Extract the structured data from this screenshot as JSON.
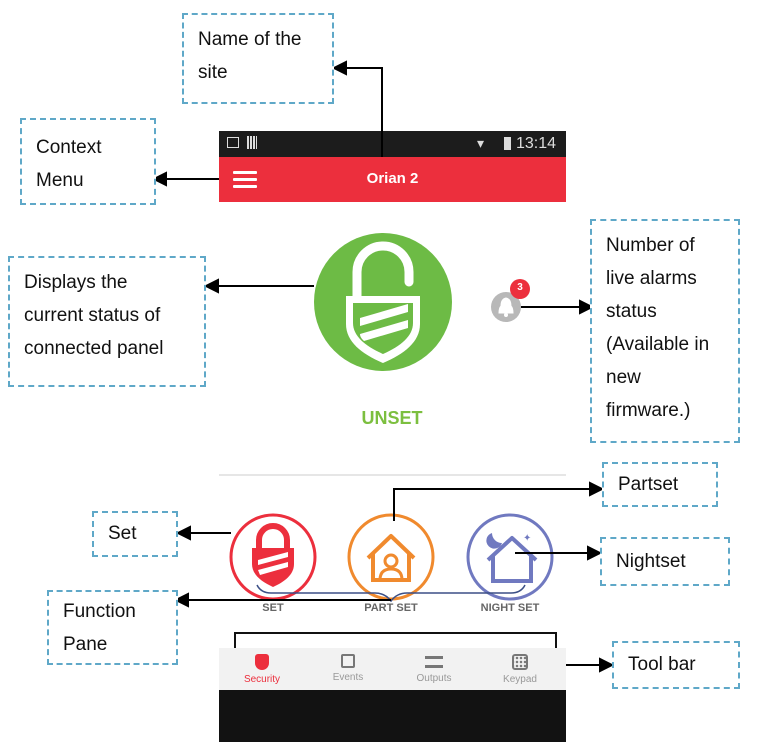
{
  "status_bar": {
    "time": "13:14"
  },
  "app_bar": {
    "title": "Orian 2"
  },
  "status": {
    "label": "UNSET",
    "alarm_count": "3"
  },
  "functions": [
    {
      "label": "SET"
    },
    {
      "label": "PART SET"
    },
    {
      "label": "NIGHT SET"
    }
  ],
  "toolbar": [
    {
      "label": "Security",
      "icon": "shield-icon",
      "active": true
    },
    {
      "label": "Events",
      "icon": "calendar-icon",
      "active": false
    },
    {
      "label": "Outputs",
      "icon": "toggles-icon",
      "active": false
    },
    {
      "label": "Keypad",
      "icon": "keypad-icon",
      "active": false
    }
  ],
  "callouts": {
    "site_name": "Name of the site",
    "context_menu": "Context Menu",
    "status_display": "Displays the current status of connected panel",
    "live_alarms": "Number of live alarms status (Available in new firmware.)",
    "partset": "Partset",
    "set": "Set",
    "nightset": "Nightset",
    "function_pane": "Function Pane",
    "tool_bar": "Tool bar"
  },
  "colors": {
    "brand_red": "#ec2f3d",
    "unset_green": "#6dbb45",
    "partset_orange": "#f08a2e",
    "nightset_blue": "#7079c0",
    "callout_border": "#5fa8c8"
  }
}
